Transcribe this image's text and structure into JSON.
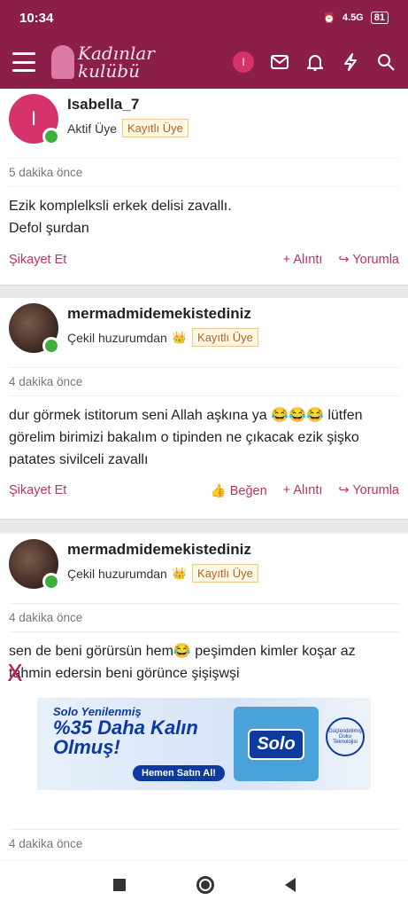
{
  "status": {
    "time": "10:34",
    "network": "4.5G",
    "battery": "81"
  },
  "header": {
    "logo_line1": "Kadınlar",
    "logo_line2": "kulübü",
    "user_initial": "I"
  },
  "posts": [
    {
      "username": "Isabella_7",
      "avatar_initial": "I",
      "role": "Aktif Üye",
      "badge": "Kayıtlı Üye",
      "time": "5 dakika önce",
      "line1": "Ezik komplelksli erkek delisi zavallı.",
      "line2": "Defol şurdan",
      "report": "Şikayet Et",
      "quote": "+ Alıntı",
      "reply": "Yorumla"
    },
    {
      "username": "mermadmidemekistediniz",
      "role": "Çekil huzurumdan",
      "badge": "Kayıtlı Üye",
      "time": "4 dakika önce",
      "line1": "dur görmek istitorum seni Allah aşkına ya 😂😂😂 lütfen",
      "line2": "görelim birimizi bakalım o tipinden ne çıkacak ezik şişko",
      "line3": "patates sivilceli zavallı",
      "report": "Şikayet Et",
      "like": "Beğen",
      "quote": "+ Alıntı",
      "reply": "Yorumla"
    },
    {
      "username": "mermadmidemekistediniz",
      "role": "Çekil huzurumdan",
      "badge": "Kayıtlı Üye",
      "time": "4 dakika önce",
      "line1": "sen de beni görürsün hem😂 peşimden kimler koşar az",
      "line2": "tahmin edersin beni görünce şişişwşi"
    },
    {
      "time": "4 dakika önce"
    }
  ],
  "ad": {
    "close": "X",
    "line1": "Solo Yenilenmiş",
    "line2": "%35 Daha Kalın",
    "line3": "Olmuş!",
    "button": "Hemen Satın Al!",
    "brand": "Solo",
    "seal": "Güçlendirilmiş Doku Teknolojisi"
  }
}
